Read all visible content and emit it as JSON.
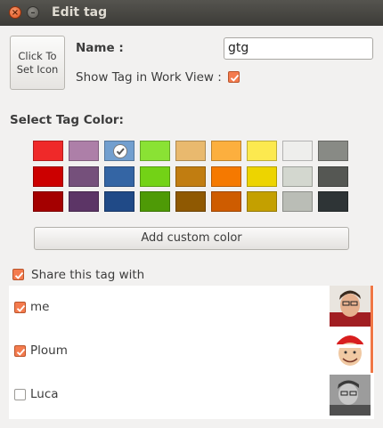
{
  "window": {
    "title": "Edit tag"
  },
  "icon_button": {
    "label_line1": "Click To",
    "label_line2": "Set Icon"
  },
  "name": {
    "label": "Name :",
    "value": "gtg"
  },
  "show_in_work_view": {
    "label": "Show Tag in Work View :",
    "checked": true
  },
  "color_section": {
    "label": "Select Tag Color:",
    "selected_index": 2
  },
  "colors": [
    [
      "#ef2929",
      "#ad7fa8",
      "#729fcf",
      "#8ae234",
      "#e9b96e",
      "#fcaf3e",
      "#fce94f",
      "#eeeeec",
      "#888a85"
    ],
    [
      "#cc0000",
      "#75507b",
      "#3465a4",
      "#73d216",
      "#c17d11",
      "#f57900",
      "#edd400",
      "#d3d7cf",
      "#555753"
    ],
    [
      "#a40000",
      "#5c3566",
      "#204a87",
      "#4e9a06",
      "#8f5902",
      "#ce5c00",
      "#c4a000",
      "#babdb6",
      "#2e3436"
    ]
  ],
  "add_custom_color": {
    "label": "Add custom color"
  },
  "share": {
    "label": "Share this tag with",
    "checked": true
  },
  "contacts": [
    {
      "name": "me",
      "checked": true
    },
    {
      "name": "Ploum",
      "checked": true
    },
    {
      "name": "Luca",
      "checked": false
    }
  ],
  "accent": "#f07746"
}
